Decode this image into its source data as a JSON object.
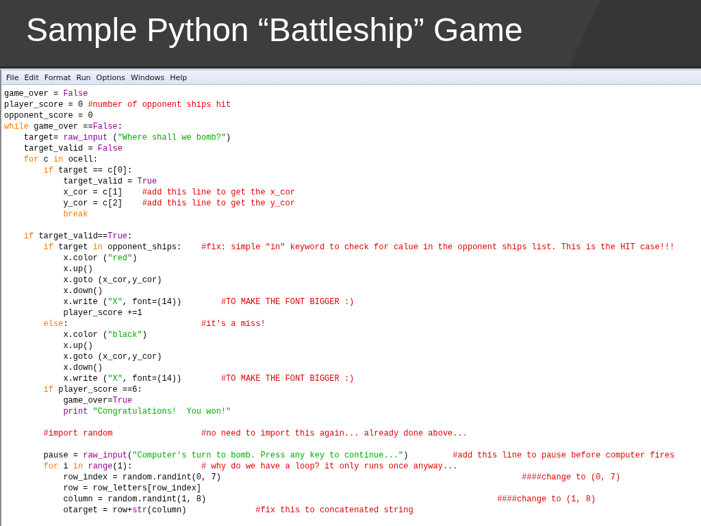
{
  "slide": {
    "title": "Sample Python “Battleship” Game"
  },
  "menu": [
    {
      "label": "File"
    },
    {
      "label": "Edit"
    },
    {
      "label": "Format"
    },
    {
      "label": "Run"
    },
    {
      "label": "Options"
    },
    {
      "label": "Windows"
    },
    {
      "label": "Help"
    }
  ],
  "code_lines": [
    {
      "kind": "code",
      "tokens": [
        {
          "kind": "plain",
          "text": "game_over = "
        },
        {
          "kind": "builtin",
          "text": "False"
        }
      ]
    },
    {
      "kind": "code",
      "tokens": [
        {
          "kind": "plain",
          "text": "player_score = 0 "
        },
        {
          "kind": "comment",
          "text": "#number of opponent ships hit"
        }
      ]
    },
    {
      "kind": "code",
      "tokens": [
        {
          "kind": "plain",
          "text": "opponent_score = 0"
        }
      ]
    },
    {
      "kind": "code",
      "tokens": [
        {
          "kind": "keyword",
          "text": "while"
        },
        {
          "kind": "plain",
          "text": " game_over =="
        },
        {
          "kind": "builtin",
          "text": "False"
        },
        {
          "kind": "plain",
          "text": ":"
        }
      ]
    },
    {
      "kind": "code",
      "tokens": [
        {
          "kind": "plain",
          "text": "    target= "
        },
        {
          "kind": "builtin",
          "text": "raw_input"
        },
        {
          "kind": "plain",
          "text": " ("
        },
        {
          "kind": "string",
          "text": "\"Where shall we bomb?\""
        },
        {
          "kind": "plain",
          "text": ")"
        }
      ]
    },
    {
      "kind": "code",
      "tokens": [
        {
          "kind": "plain",
          "text": "    target_valid = "
        },
        {
          "kind": "builtin",
          "text": "False"
        }
      ]
    },
    {
      "kind": "code",
      "tokens": [
        {
          "kind": "keyword",
          "text": "    for"
        },
        {
          "kind": "plain",
          "text": " c "
        },
        {
          "kind": "keyword",
          "text": "in"
        },
        {
          "kind": "plain",
          "text": " ocell:"
        }
      ]
    },
    {
      "kind": "code",
      "tokens": [
        {
          "kind": "keyword",
          "text": "        if"
        },
        {
          "kind": "plain",
          "text": " target == c[0]:"
        }
      ]
    },
    {
      "kind": "code",
      "tokens": [
        {
          "kind": "plain",
          "text": "            target_valid = "
        },
        {
          "kind": "builtin",
          "text": "True"
        }
      ]
    },
    {
      "kind": "code",
      "tokens": [
        {
          "kind": "plain",
          "text": "            x_cor = c[1]    "
        },
        {
          "kind": "comment",
          "text": "#add this line to get the x_cor"
        }
      ]
    },
    {
      "kind": "code",
      "tokens": [
        {
          "kind": "plain",
          "text": "            y_cor = c[2]    "
        },
        {
          "kind": "comment",
          "text": "#add this line to get the y_cor"
        }
      ]
    },
    {
      "kind": "code",
      "tokens": [
        {
          "kind": "keyword",
          "text": "            break"
        }
      ]
    },
    {
      "kind": "blank"
    },
    {
      "kind": "code",
      "tokens": [
        {
          "kind": "keyword",
          "text": "    if"
        },
        {
          "kind": "plain",
          "text": " target_valid=="
        },
        {
          "kind": "builtin",
          "text": "True"
        },
        {
          "kind": "plain",
          "text": ":"
        }
      ]
    },
    {
      "kind": "code",
      "tokens": [
        {
          "kind": "keyword",
          "text": "        if"
        },
        {
          "kind": "plain",
          "text": " target "
        },
        {
          "kind": "keyword",
          "text": "in"
        },
        {
          "kind": "plain",
          "text": " opponent_ships:    "
        },
        {
          "kind": "comment",
          "text": "#fix: simple \"in\" keyword to check for calue in the opponent ships list. This is the HIT case!!!"
        }
      ]
    },
    {
      "kind": "code",
      "tokens": [
        {
          "kind": "plain",
          "text": "            x.color ("
        },
        {
          "kind": "string",
          "text": "\"red\""
        },
        {
          "kind": "plain",
          "text": ")"
        }
      ]
    },
    {
      "kind": "code",
      "tokens": [
        {
          "kind": "plain",
          "text": "            x.up()"
        }
      ]
    },
    {
      "kind": "code",
      "tokens": [
        {
          "kind": "plain",
          "text": "            x.goto (x_cor,y_cor)"
        }
      ]
    },
    {
      "kind": "code",
      "tokens": [
        {
          "kind": "plain",
          "text": "            x.down()"
        }
      ]
    },
    {
      "kind": "code",
      "tokens": [
        {
          "kind": "plain",
          "text": "            x.write ("
        },
        {
          "kind": "string",
          "text": "\"X\""
        },
        {
          "kind": "plain",
          "text": ", font=(14))        "
        },
        {
          "kind": "comment",
          "text": "#TO MAKE THE FONT BIGGER :)"
        }
      ]
    },
    {
      "kind": "code",
      "tokens": [
        {
          "kind": "plain",
          "text": "            player_score +=1"
        }
      ]
    },
    {
      "kind": "code",
      "tokens": [
        {
          "kind": "keyword",
          "text": "        else"
        },
        {
          "kind": "plain",
          "text": ":                           "
        },
        {
          "kind": "comment",
          "text": "#it's a miss!"
        }
      ]
    },
    {
      "kind": "code",
      "tokens": [
        {
          "kind": "plain",
          "text": "            x.color ("
        },
        {
          "kind": "string",
          "text": "\"black\""
        },
        {
          "kind": "plain",
          "text": ")"
        }
      ]
    },
    {
      "kind": "code",
      "tokens": [
        {
          "kind": "plain",
          "text": "            x.up()"
        }
      ]
    },
    {
      "kind": "code",
      "tokens": [
        {
          "kind": "plain",
          "text": "            x.goto (x_cor,y_cor)"
        }
      ]
    },
    {
      "kind": "code",
      "tokens": [
        {
          "kind": "plain",
          "text": "            x.down()"
        }
      ]
    },
    {
      "kind": "code",
      "tokens": [
        {
          "kind": "plain",
          "text": "            x.write ("
        },
        {
          "kind": "string",
          "text": "\"X\""
        },
        {
          "kind": "plain",
          "text": ", font=(14))        "
        },
        {
          "kind": "comment",
          "text": "#TO MAKE THE FONT BIGGER :)"
        }
      ]
    },
    {
      "kind": "code",
      "tokens": [
        {
          "kind": "keyword",
          "text": "        if"
        },
        {
          "kind": "plain",
          "text": " player_score ==6:"
        }
      ]
    },
    {
      "kind": "code",
      "tokens": [
        {
          "kind": "plain",
          "text": "            game_over="
        },
        {
          "kind": "builtin",
          "text": "True"
        }
      ]
    },
    {
      "kind": "code",
      "tokens": [
        {
          "kind": "builtin",
          "text": "            print"
        },
        {
          "kind": "string",
          "text": " \"Congratulations!  You won!\""
        }
      ]
    },
    {
      "kind": "blank"
    },
    {
      "kind": "code",
      "tokens": [
        {
          "kind": "comment",
          "text": "        #import random                  #no need to import this again... already done above..."
        }
      ]
    },
    {
      "kind": "blank"
    },
    {
      "kind": "code",
      "tokens": [
        {
          "kind": "plain",
          "text": "        pause = "
        },
        {
          "kind": "builtin",
          "text": "raw_input"
        },
        {
          "kind": "plain",
          "text": "("
        },
        {
          "kind": "string",
          "text": "\"Computer's turn to bomb. Press any key to continue...\""
        },
        {
          "kind": "plain",
          "text": ")         "
        },
        {
          "kind": "comment",
          "text": "#add this line to pause before computer fires"
        }
      ]
    },
    {
      "kind": "code",
      "tokens": [
        {
          "kind": "keyword",
          "text": "        for"
        },
        {
          "kind": "plain",
          "text": " i "
        },
        {
          "kind": "keyword",
          "text": "in"
        },
        {
          "kind": "builtin",
          "text": " range"
        },
        {
          "kind": "plain",
          "text": "(1):              "
        },
        {
          "kind": "comment",
          "text": "# why do we have a loop? it only runs once anyway..."
        }
      ]
    },
    {
      "kind": "code",
      "tokens": [
        {
          "kind": "plain",
          "text": "            row_index = random.randint(0, 7)                                                             "
        },
        {
          "kind": "comment",
          "text": "####change to (0, 7)"
        }
      ]
    },
    {
      "kind": "code",
      "tokens": [
        {
          "kind": "plain",
          "text": "            row = row_letters[row_index]"
        }
      ]
    },
    {
      "kind": "code",
      "tokens": [
        {
          "kind": "plain",
          "text": "            column = random.randint(1, 8)                                                           "
        },
        {
          "kind": "comment",
          "text": "####change to (1, 8)"
        }
      ]
    },
    {
      "kind": "code",
      "tokens": [
        {
          "kind": "plain",
          "text": "            otarget = row+"
        },
        {
          "kind": "builtin",
          "text": "str"
        },
        {
          "kind": "plain",
          "text": "(column)              "
        },
        {
          "kind": "comment",
          "text": "#fix this to concatenated string"
        }
      ]
    }
  ]
}
